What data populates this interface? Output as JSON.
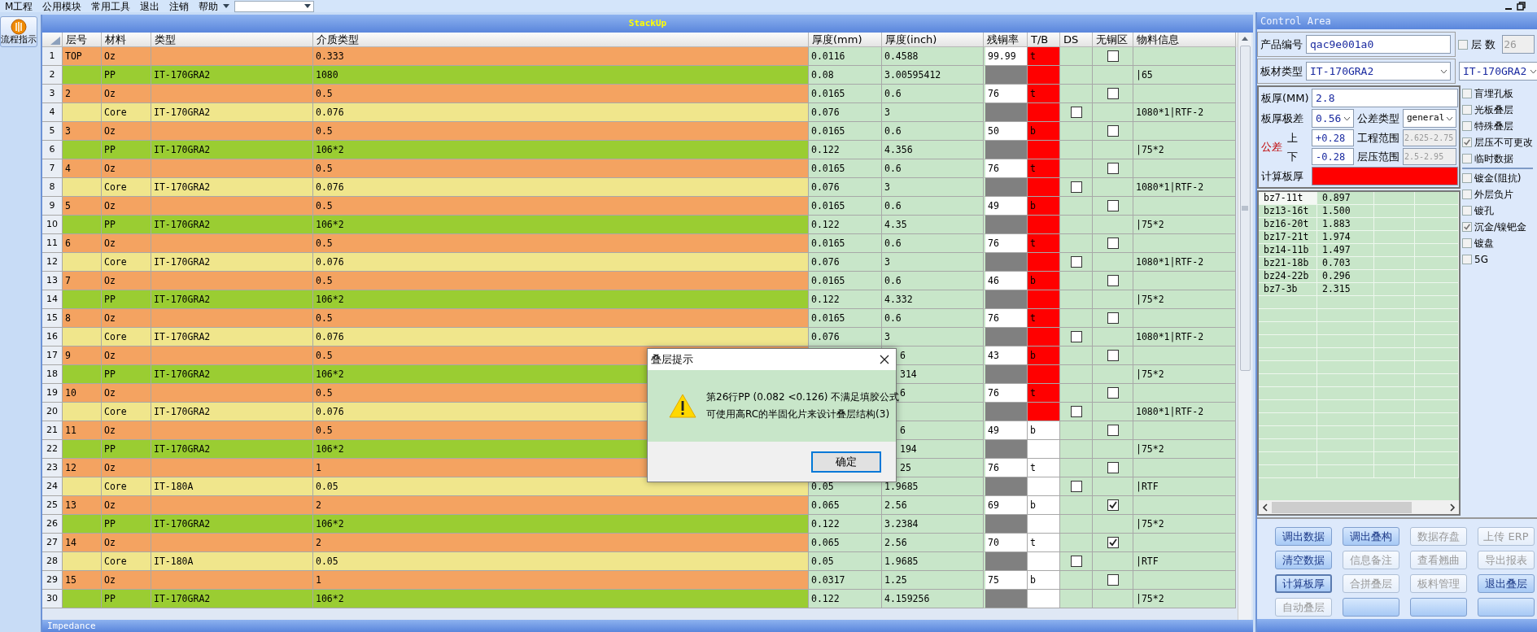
{
  "menu": [
    {
      "label": "M工程"
    },
    {
      "label": "公用模块"
    },
    {
      "label": "常用工具"
    },
    {
      "label": "退出"
    },
    {
      "label": "注销"
    },
    {
      "label": "帮助"
    }
  ],
  "sidebar": {
    "button": "流程指示"
  },
  "stackup": {
    "title": "StackUp",
    "columns": [
      "层号",
      "材料",
      "类型",
      "介质类型",
      "厚度(mm)",
      "厚度(inch)",
      "残铜率",
      "T/B",
      "DS",
      "无铜区",
      "物料信息"
    ],
    "rows": [
      {
        "no": "1",
        "kind": "copper",
        "layer": "TOP",
        "material": "Oz",
        "dielectric": "0.333",
        "mm": "0.0116",
        "inch": "0.4588",
        "residual": "99.99",
        "tb": "t",
        "tb_alert": true,
        "no_copper_checked": false
      },
      {
        "no": "2",
        "kind": "pp",
        "material": "PP",
        "type": "IT-170GRA2",
        "dielectric": "1080",
        "mm": "0.08",
        "inch": "3.00595412",
        "tb_alert": true,
        "info": "|65"
      },
      {
        "no": "3",
        "kind": "copper",
        "layer": "2",
        "material": "Oz",
        "dielectric": "0.5",
        "mm": "0.0165",
        "inch": "0.6",
        "residual": "76",
        "tb": "t",
        "tb_alert": true,
        "no_copper_checked": false
      },
      {
        "no": "4",
        "kind": "core",
        "material": "Core",
        "type": "IT-170GRA2",
        "dielectric": "0.076",
        "mm": "0.076",
        "inch": "3",
        "tb_alert": true,
        "ds_checked": false,
        "info": "1080*1|RTF-2"
      },
      {
        "no": "5",
        "kind": "copper",
        "layer": "3",
        "material": "Oz",
        "dielectric": "0.5",
        "mm": "0.0165",
        "inch": "0.6",
        "residual": "50",
        "tb": "b",
        "tb_alert": true,
        "no_copper_checked": false
      },
      {
        "no": "6",
        "kind": "pp",
        "material": "PP",
        "type": "IT-170GRA2",
        "dielectric": "106*2",
        "mm": "0.122",
        "inch": "4.356",
        "tb_alert": true,
        "info": "|75*2"
      },
      {
        "no": "7",
        "kind": "copper",
        "layer": "4",
        "material": "Oz",
        "dielectric": "0.5",
        "mm": "0.0165",
        "inch": "0.6",
        "residual": "76",
        "tb": "t",
        "tb_alert": true,
        "no_copper_checked": false
      },
      {
        "no": "8",
        "kind": "core",
        "material": "Core",
        "type": "IT-170GRA2",
        "dielectric": "0.076",
        "mm": "0.076",
        "inch": "3",
        "tb_alert": true,
        "ds_checked": false,
        "info": "1080*1|RTF-2"
      },
      {
        "no": "9",
        "kind": "copper",
        "layer": "5",
        "material": "Oz",
        "dielectric": "0.5",
        "mm": "0.0165",
        "inch": "0.6",
        "residual": "49",
        "tb": "b",
        "tb_alert": true,
        "no_copper_checked": false
      },
      {
        "no": "10",
        "kind": "pp",
        "material": "PP",
        "type": "IT-170GRA2",
        "dielectric": "106*2",
        "mm": "0.122",
        "inch": "4.35",
        "tb_alert": true,
        "info": "|75*2"
      },
      {
        "no": "11",
        "kind": "copper",
        "layer": "6",
        "material": "Oz",
        "dielectric": "0.5",
        "mm": "0.0165",
        "inch": "0.6",
        "residual": "76",
        "tb": "t",
        "tb_alert": true,
        "no_copper_checked": false
      },
      {
        "no": "12",
        "kind": "core",
        "material": "Core",
        "type": "IT-170GRA2",
        "dielectric": "0.076",
        "mm": "0.076",
        "inch": "3",
        "tb_alert": true,
        "ds_checked": false,
        "info": "1080*1|RTF-2"
      },
      {
        "no": "13",
        "kind": "copper",
        "layer": "7",
        "material": "Oz",
        "dielectric": "0.5",
        "mm": "0.0165",
        "inch": "0.6",
        "residual": "46",
        "tb": "b",
        "tb_alert": true,
        "no_copper_checked": false
      },
      {
        "no": "14",
        "kind": "pp",
        "material": "PP",
        "type": "IT-170GRA2",
        "dielectric": "106*2",
        "mm": "0.122",
        "inch": "4.332",
        "tb_alert": true,
        "info": "|75*2"
      },
      {
        "no": "15",
        "kind": "copper",
        "layer": "8",
        "material": "Oz",
        "dielectric": "0.5",
        "mm": "0.0165",
        "inch": "0.6",
        "residual": "76",
        "tb": "t",
        "tb_alert": true,
        "no_copper_checked": false
      },
      {
        "no": "16",
        "kind": "core",
        "material": "Core",
        "type": "IT-170GRA2",
        "dielectric": "0.076",
        "mm": "0.076",
        "inch": "3",
        "tb_alert": true,
        "ds_checked": false,
        "info": "1080*1|RTF-2"
      },
      {
        "no": "17",
        "kind": "copper",
        "layer": "9",
        "material": "Oz",
        "dielectric": "0.5",
        "inch": "6",
        "inch_clipped": true,
        "residual": "43",
        "tb": "b",
        "tb_alert": true,
        "no_copper_checked": false
      },
      {
        "no": "18",
        "kind": "pp",
        "material": "PP",
        "type": "IT-170GRA2",
        "dielectric": "106*2",
        "inch": "314",
        "inch_clipped": true,
        "tb_alert": true,
        "info": "|75*2"
      },
      {
        "no": "19",
        "kind": "copper",
        "layer": "10",
        "material": "Oz",
        "dielectric": "0.5",
        "inch": "6",
        "inch_clipped": true,
        "residual": "76",
        "tb": "t",
        "tb_alert": true,
        "no_copper_checked": false
      },
      {
        "no": "20",
        "kind": "core",
        "material": "Core",
        "type": "IT-170GRA2",
        "dielectric": "0.076",
        "tb_alert": true,
        "ds_checked": false,
        "info": "1080*1|RTF-2"
      },
      {
        "no": "21",
        "kind": "copper",
        "layer": "11",
        "material": "Oz",
        "dielectric": "0.5",
        "inch": "6",
        "inch_clipped": true,
        "residual": "49",
        "tb": "b",
        "tb_alert": false,
        "no_copper_checked": false
      },
      {
        "no": "22",
        "kind": "pp",
        "material": "PP",
        "type": "IT-170GRA2",
        "dielectric": "106*2",
        "inch": "194",
        "inch_clipped": true,
        "tb_alert": false,
        "info": "|75*2"
      },
      {
        "no": "23",
        "kind": "copper",
        "layer": "12",
        "material": "Oz",
        "dielectric": "1",
        "inch": "25",
        "inch_clipped": true,
        "residual": "76",
        "tb": "t",
        "tb_alert": false,
        "no_copper_checked": false
      },
      {
        "no": "24",
        "kind": "core",
        "material": "Core",
        "type": "IT-180A",
        "dielectric": "0.05",
        "mm": "0.05",
        "inch": "1.9685",
        "tb_alert": false,
        "ds_checked": false,
        "info": "|RTF"
      },
      {
        "no": "25",
        "kind": "copper",
        "layer": "13",
        "material": "Oz",
        "dielectric": "2",
        "mm": "0.065",
        "inch": "2.56",
        "residual": "69",
        "tb": "b",
        "tb_alert": false,
        "no_copper_checked": true
      },
      {
        "no": "26",
        "kind": "pp",
        "material": "PP",
        "type": "IT-170GRA2",
        "dielectric": "106*2",
        "mm": "0.122",
        "inch": "3.2384",
        "tb_alert": false,
        "info": "|75*2"
      },
      {
        "no": "27",
        "kind": "copper",
        "layer": "14",
        "material": "Oz",
        "dielectric": "2",
        "mm": "0.065",
        "inch": "2.56",
        "residual": "70",
        "tb": "t",
        "tb_alert": false,
        "no_copper_checked": true
      },
      {
        "no": "28",
        "kind": "core",
        "material": "Core",
        "type": "IT-180A",
        "dielectric": "0.05",
        "mm": "0.05",
        "inch": "1.9685",
        "tb_alert": false,
        "ds_checked": false,
        "info": "|RTF"
      },
      {
        "no": "29",
        "kind": "copper",
        "layer": "15",
        "material": "Oz",
        "dielectric": "1",
        "mm": "0.0317",
        "inch": "1.25",
        "residual": "75",
        "tb": "b",
        "tb_alert": false,
        "no_copper_checked": false
      },
      {
        "no": "30",
        "kind": "pp",
        "material": "PP",
        "type": "IT-170GRA2",
        "dielectric": "106*2",
        "mm": "0.122",
        "inch": "4.159256",
        "tb_alert": false,
        "info": "|75*2"
      }
    ]
  },
  "impedance": {
    "title": "Impedance"
  },
  "dialog": {
    "title": "叠层提示",
    "lines": [
      "第26行PP (0.082 <0.126) 不满足填胶公式",
      "可使用高RC的半固化片来设计叠层结构(3)"
    ],
    "button": "确定"
  },
  "control": {
    "title": "Control Area",
    "product_label": "产品编号",
    "product_value": "qac9e001a0",
    "layers_checked": false,
    "layers_label": "层 数",
    "layers_value": "26",
    "material_label": "板材类型",
    "material_value": "IT-170GRA2",
    "material_value2": "IT-170GRA2",
    "thickness_label": "板厚(MM)",
    "thickness_value": "2.8",
    "range_label": "板厚极差",
    "range_value": "0.56",
    "tol_type_label": "公差类型",
    "tol_type_value": "general",
    "tol_label": "公差",
    "upper_label": "上",
    "lower_label": "下",
    "upper_value": "+0.28",
    "lower_value": "-0.28",
    "eng_label": "工程范围",
    "eng_value": "2.625-2.75",
    "press_label": "层压范围",
    "press_value": "2.5-2.95",
    "calc_label": "计算板厚",
    "calc_alert": true,
    "results": [
      {
        "name": "bz7-11t",
        "value": "0.897",
        "selected": true
      },
      {
        "name": "bz13-16t",
        "value": "1.500",
        "selected": false
      },
      {
        "name": "bz16-20t",
        "value": "1.883",
        "selected": false
      },
      {
        "name": "bz17-21t",
        "value": "1.974",
        "selected": false
      },
      {
        "name": "bz14-11b",
        "value": "1.497",
        "selected": false
      },
      {
        "name": "bz21-18b",
        "value": "0.703",
        "selected": false
      },
      {
        "name": "bz24-22b",
        "value": "0.296",
        "selected": false
      },
      {
        "name": "bz7-3b",
        "value": "2.315",
        "selected": false
      }
    ],
    "option_groups": [
      [
        {
          "label": "盲埋孔板",
          "checked": false
        },
        {
          "label": "光板叠层",
          "checked": false
        },
        {
          "label": "特殊叠层",
          "checked": false
        },
        {
          "label": "层压不可更改",
          "checked": true
        },
        {
          "label": "临时数据",
          "checked": false
        }
      ],
      [
        {
          "label": "镀金(阻抗)",
          "checked": false
        },
        {
          "label": "外层负片",
          "checked": false
        },
        {
          "label": "镀孔",
          "checked": false
        },
        {
          "label": "沉金/镍钯金",
          "checked": true
        },
        {
          "label": "镀盘",
          "checked": false
        },
        {
          "label": "5G",
          "checked": false
        }
      ]
    ],
    "buttons": [
      {
        "label": "调出数据",
        "enabled": true,
        "focused": false
      },
      {
        "label": "调出叠构",
        "enabled": true,
        "focused": false
      },
      {
        "label": "数据存盘",
        "enabled": false,
        "focused": false
      },
      {
        "label": "上传 ERP",
        "enabled": false,
        "focused": false
      },
      {
        "label": "清空数据",
        "enabled": true,
        "focused": false
      },
      {
        "label": "信息备注",
        "enabled": false,
        "focused": false
      },
      {
        "label": "查看翘曲",
        "enabled": false,
        "focused": false
      },
      {
        "label": "导出报表",
        "enabled": false,
        "focused": false
      },
      {
        "label": "计算板厚",
        "enabled": true,
        "focused": true
      },
      {
        "label": "合拼叠层",
        "enabled": false,
        "focused": false
      },
      {
        "label": "板料管理",
        "enabled": false,
        "focused": false
      },
      {
        "label": "退出叠层",
        "enabled": true,
        "focused": false
      },
      {
        "label": "自动叠层",
        "enabled": false,
        "focused": false
      },
      {
        "enabled": true,
        "focused": false
      },
      {
        "enabled": true,
        "focused": false
      },
      {
        "enabled": true,
        "focused": false
      }
    ]
  }
}
